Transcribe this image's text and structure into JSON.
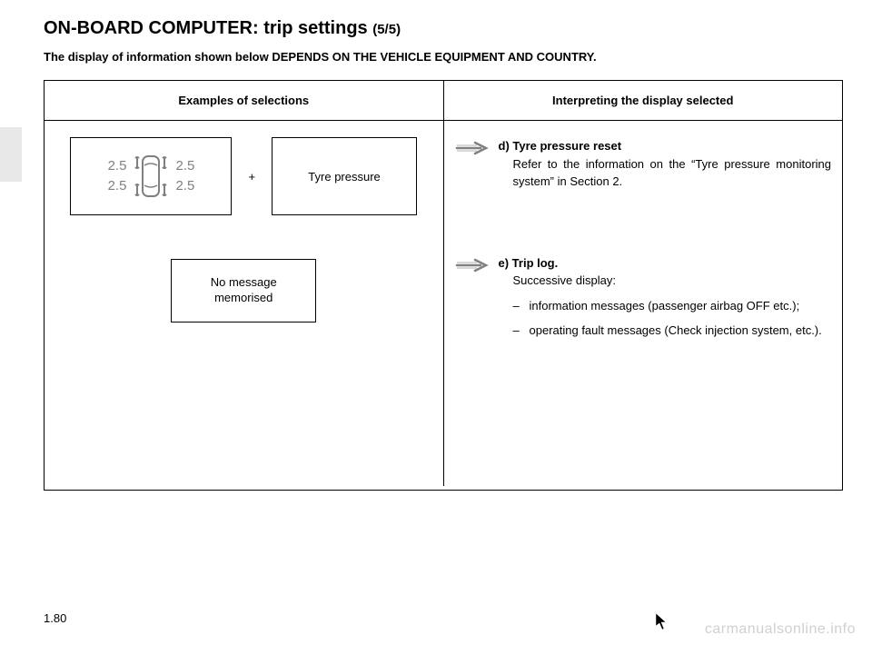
{
  "title_main": "ON-BOARD COMPUTER: trip settings ",
  "title_sub": "(5/5)",
  "note": "The display of information shown below DEPENDS ON THE VEHICLE EQUIPMENT AND COUNTRY.",
  "table": {
    "header_left": "Examples of selections",
    "header_right": "Interpreting the display selected"
  },
  "tyre_values": {
    "fl": "2.5",
    "rl": "2.5",
    "fr": "2.5",
    "rr": "2.5"
  },
  "plus": "+",
  "tyre_label": "Tyre pressure",
  "msg_line1": "No message",
  "msg_line2": "memorised",
  "entry_d": {
    "label": "d) Tyre pressure reset",
    "text": "Refer to the information on the “Tyre pressure monitoring system” in Section 2."
  },
  "entry_e": {
    "label": "e) Trip log.",
    "sub": "Successive display:",
    "bullet1": "information messages (passenger airbag OFF etc.);",
    "bullet2": "operating fault messages (Check injection system, etc.)."
  },
  "page_num": "1.80",
  "watermark": "carmanualsonline.info"
}
